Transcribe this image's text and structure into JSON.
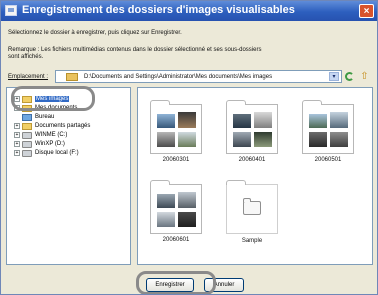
{
  "window": {
    "title": "Enregistrement des dossiers d'images visualisables",
    "close_symbol": "×"
  },
  "instruction": "Sélectionnez le dossier à enregistrer, puis cliquez sur Enregistrer.",
  "remark": {
    "line1": "Remarque : Les fichiers multimédias contenus dans le dossier sélectionné et ses sous-dossiers",
    "line2": "sont affichés."
  },
  "location": {
    "label": "Emplacement :",
    "path": "D:\\Documents and Settings\\Administrator\\Mes documents\\Mes images",
    "dropdown_symbol": "▾",
    "up_symbol": "⇧"
  },
  "tree": {
    "expand_symbol": "+",
    "items": [
      {
        "label": "Mes images",
        "icon": "pictures-folder-icon",
        "expander": true
      },
      {
        "label": "Mes documents",
        "icon": "documents-folder-icon",
        "expander": true
      },
      {
        "label": "Bureau",
        "icon": "desktop-icon",
        "expander": false
      },
      {
        "label": "Documents partagés",
        "icon": "shared-folder-icon",
        "expander": true
      },
      {
        "label": "WINME (C:)",
        "icon": "drive-icon",
        "expander": true
      },
      {
        "label": "WinXP (D:)",
        "icon": "drive-icon",
        "expander": true
      },
      {
        "label": "Disque local (F:)",
        "icon": "drive-icon",
        "expander": true
      }
    ]
  },
  "folders": [
    {
      "label": "20060301"
    },
    {
      "label": "20060401"
    },
    {
      "label": "20060501"
    },
    {
      "label": "20060601"
    },
    {
      "label": "Sample"
    }
  ],
  "buttons": {
    "save": "Enregistrer",
    "cancel": "Annuler"
  },
  "colors": {
    "titlebar": "#2d5fbe",
    "selection": "#316ac5",
    "highlight_ring": "#8a8a8a"
  }
}
